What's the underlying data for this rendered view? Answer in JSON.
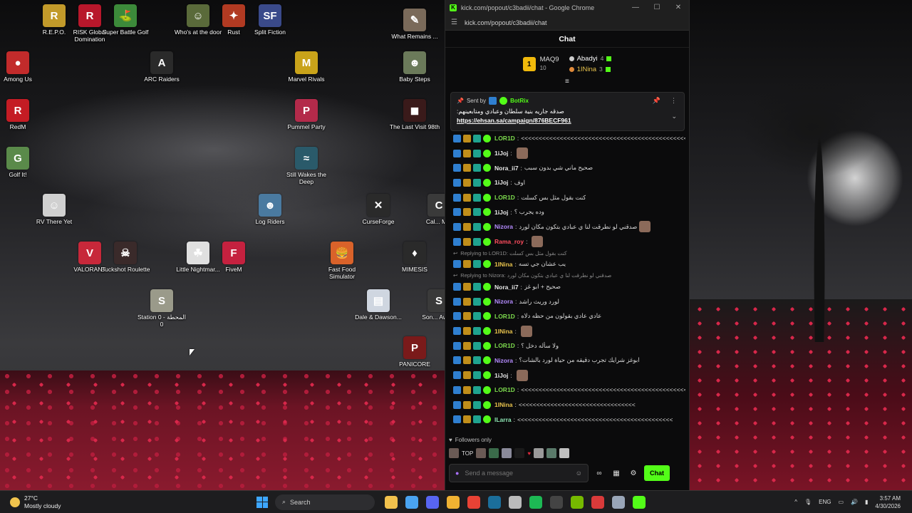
{
  "desktop": {
    "icons": [
      {
        "label": "R.E.P.O.",
        "color": "#c29a2a",
        "glyph": "R"
      },
      {
        "label": "RISK Global Domination",
        "color": "#b8172b",
        "glyph": "R"
      },
      {
        "label": "Super Battle Golf",
        "color": "#3c8a3a",
        "glyph": "⛳"
      },
      {
        "label": "Who's at the door",
        "color": "#5a6a3a",
        "glyph": "☺"
      },
      {
        "label": "Rust",
        "color": "#b13a22",
        "glyph": "✦"
      },
      {
        "label": "Split Fiction",
        "color": "#3a4a8a",
        "glyph": "SF"
      },
      {
        "label": "What Remains ...",
        "color": "#7a6a5a",
        "glyph": "✎"
      },
      {
        "label": "Among Us",
        "color": "#c22b2b",
        "glyph": "●"
      },
      {
        "label": "ARC Raiders",
        "color": "#2a2a2a",
        "glyph": "A"
      },
      {
        "label": "Marvel Rivals",
        "color": "#c9a31a",
        "glyph": "M"
      },
      {
        "label": "Baby Steps",
        "color": "#6b7a5a",
        "glyph": "☻"
      },
      {
        "label": "RedM",
        "color": "#c41c24",
        "glyph": "R"
      },
      {
        "label": "Pummel Party",
        "color": "#b32a4a",
        "glyph": "P"
      },
      {
        "label": "The Last Visit 98th",
        "color": "#3a1a1a",
        "glyph": "◼"
      },
      {
        "label": "Golf It!",
        "color": "#5a8a4a",
        "glyph": "G"
      },
      {
        "label": "Still Wakes the Deep",
        "color": "#2a5a6a",
        "glyph": "≈"
      },
      {
        "label": "RV There Yet",
        "color": "#d0d0d0",
        "glyph": "☺"
      },
      {
        "label": "Log Riders",
        "color": "#4a7aa0",
        "glyph": "☻"
      },
      {
        "label": "CurseForge",
        "color": "#2a2a2a",
        "glyph": "✕"
      },
      {
        "label": "Cal... M...",
        "color": "#3a3a3a",
        "glyph": "C"
      },
      {
        "label": "VALORANT",
        "color": "#c7283a",
        "glyph": "V"
      },
      {
        "label": "Buckshot Roulette",
        "color": "#3a2a2a",
        "glyph": "☠"
      },
      {
        "label": "Little Nightmar...",
        "color": "#e0e0e0",
        "glyph": "☘"
      },
      {
        "label": "FiveM",
        "color": "#c5213f",
        "glyph": "F"
      },
      {
        "label": "Fast Food Simulator",
        "color": "#d9622a",
        "glyph": "🍔"
      },
      {
        "label": "MIMESIS",
        "color": "#2a2a2a",
        "glyph": "♦"
      },
      {
        "label": "Station 0 - المحطة 0",
        "color": "#9a9a8a",
        "glyph": "S"
      },
      {
        "label": "Dale & Dawson...",
        "color": "#cfd6e0",
        "glyph": "▤"
      },
      {
        "label": "Son... Awa...",
        "color": "#3a3a3a",
        "glyph": "S"
      },
      {
        "label": "PANICORE",
        "color": "#7a1a1a",
        "glyph": "P"
      }
    ]
  },
  "window": {
    "title": "kick.com/popout/c3badii/chat - Google Chrome",
    "url": "kick.com/popout/c3badii/chat",
    "brand_color": "#53fc18"
  },
  "chat": {
    "header": "Chat",
    "leaderboard": {
      "top_name": "MAQ9",
      "top_count": "10",
      "others": [
        {
          "name": "Abadyi",
          "count": "4"
        },
        {
          "name": "1INina",
          "count": "3"
        }
      ]
    },
    "pinned": {
      "sent_by_label": "Sent by",
      "bot_name": "BotRix",
      "message": "صدقه جاريه بنية سلطان وعبادي ومتابعينهم:",
      "link": "https://ehsan.sa/campaign/876BECF961"
    },
    "messages": [
      {
        "user": "LOR1D",
        "cls": "u-green",
        "text": "<<<<<<<<<<<<<<<<<<<<<<<<<<<<<<<<<<<<<<<<<<<<<<<<<",
        "emote": false
      },
      {
        "user": "1iJoj",
        "cls": "u-white",
        "text": "",
        "emote": true
      },
      {
        "user": "Nora_ii7",
        "cls": "u-white",
        "text": "صحيح ماني شي بدون سبب",
        "emote": false
      },
      {
        "user": "1iJoj",
        "cls": "u-white",
        "text": "اوف",
        "emote": false
      },
      {
        "user": "LOR1D",
        "cls": "u-green",
        "text": "كنت بقول مثل بس كسلت",
        "emote": false
      },
      {
        "user": "1iJoj",
        "cls": "u-white",
        "text": "وده يجرب ؟",
        "emote": false
      },
      {
        "user": "Nizora",
        "cls": "u-purple",
        "text": "صدقني لو نطرقت لنا ي عبادي بتكون مكان لورد",
        "emote": true
      },
      {
        "user": "Rama_roy",
        "cls": "u-red",
        "text": "",
        "emote": true
      },
      {
        "user": "1INina",
        "cls": "u-yellow",
        "text": "يب عشان جي تسه",
        "emote": false,
        "reply": "Replying to LOR1D: كنت بقول مثل بس كسلت"
      },
      {
        "user": "Nora_ii7",
        "cls": "u-white",
        "text": "صحيح + ابو غز",
        "emote": false,
        "reply": "Replying to Nizora: صدقني لو نطرقت لنا ي عبادي بتكون مكان لورد"
      },
      {
        "user": "Nizora",
        "cls": "u-purple",
        "text": "لورد وريث راشد",
        "emote": false
      },
      {
        "user": "LOR1D",
        "cls": "u-green",
        "text": "عادي عادي بقولون من حظه دلاه",
        "emote": false
      },
      {
        "user": "1INina",
        "cls": "u-yellow",
        "text": "",
        "emote": true
      },
      {
        "user": "LOR1D",
        "cls": "u-green",
        "text": "ولا سأله دخل ؟",
        "emote": false
      },
      {
        "user": "Nizora",
        "cls": "u-purple",
        "text": "ابوغز شرايك تجرب دقيقه من حياة لورد بالشات؟",
        "emote": false
      },
      {
        "user": "1iJoj",
        "cls": "u-white",
        "text": "",
        "emote": true
      },
      {
        "user": "LOR1D",
        "cls": "u-green",
        "text": "<<<<<<<<<<<<<<<<<<<<<<<<<<<<<<<<<<<<<<<<<<<<<<<<<",
        "emote": false
      },
      {
        "user": "1INina",
        "cls": "u-yellow",
        "text": "<<<<<<<<<<<<<<<<<<<<<<<<<<<<<<<<<",
        "emote": false
      },
      {
        "user": "lLarra",
        "cls": "u-mint",
        "text": "<<<<<<<<<<<<<<<<<<<<<<<<<<<<<<<<<<<<<<<<<<<<",
        "emote": false
      }
    ],
    "followers_only": "Followers only",
    "top_label": "TOP",
    "input_placeholder": "Send a message",
    "send_label": "Chat"
  },
  "taskbar": {
    "weather_temp": "27°C",
    "weather_desc": "Mostly cloudy",
    "search_label": "Search",
    "lang": "ENG",
    "time": "3:57 AM",
    "date": "4/30/2026",
    "apps": [
      {
        "name": "file-explorer",
        "color": "#f2c14d"
      },
      {
        "name": "store",
        "color": "#4aa3f0"
      },
      {
        "name": "discord",
        "color": "#5865f2"
      },
      {
        "name": "discord-canary",
        "color": "#f0b232"
      },
      {
        "name": "chrome",
        "color": "#e94235"
      },
      {
        "name": "steam",
        "color": "#1b6e9b"
      },
      {
        "name": "settings-gear",
        "color": "#bbbbbb"
      },
      {
        "name": "spotify",
        "color": "#1db954"
      },
      {
        "name": "obs",
        "color": "#444444"
      },
      {
        "name": "nvidia",
        "color": "#76b900"
      },
      {
        "name": "app-red",
        "color": "#d93a3a"
      },
      {
        "name": "gear-active",
        "color": "#9aa6b8"
      },
      {
        "name": "kick",
        "color": "#53fc18"
      }
    ]
  }
}
